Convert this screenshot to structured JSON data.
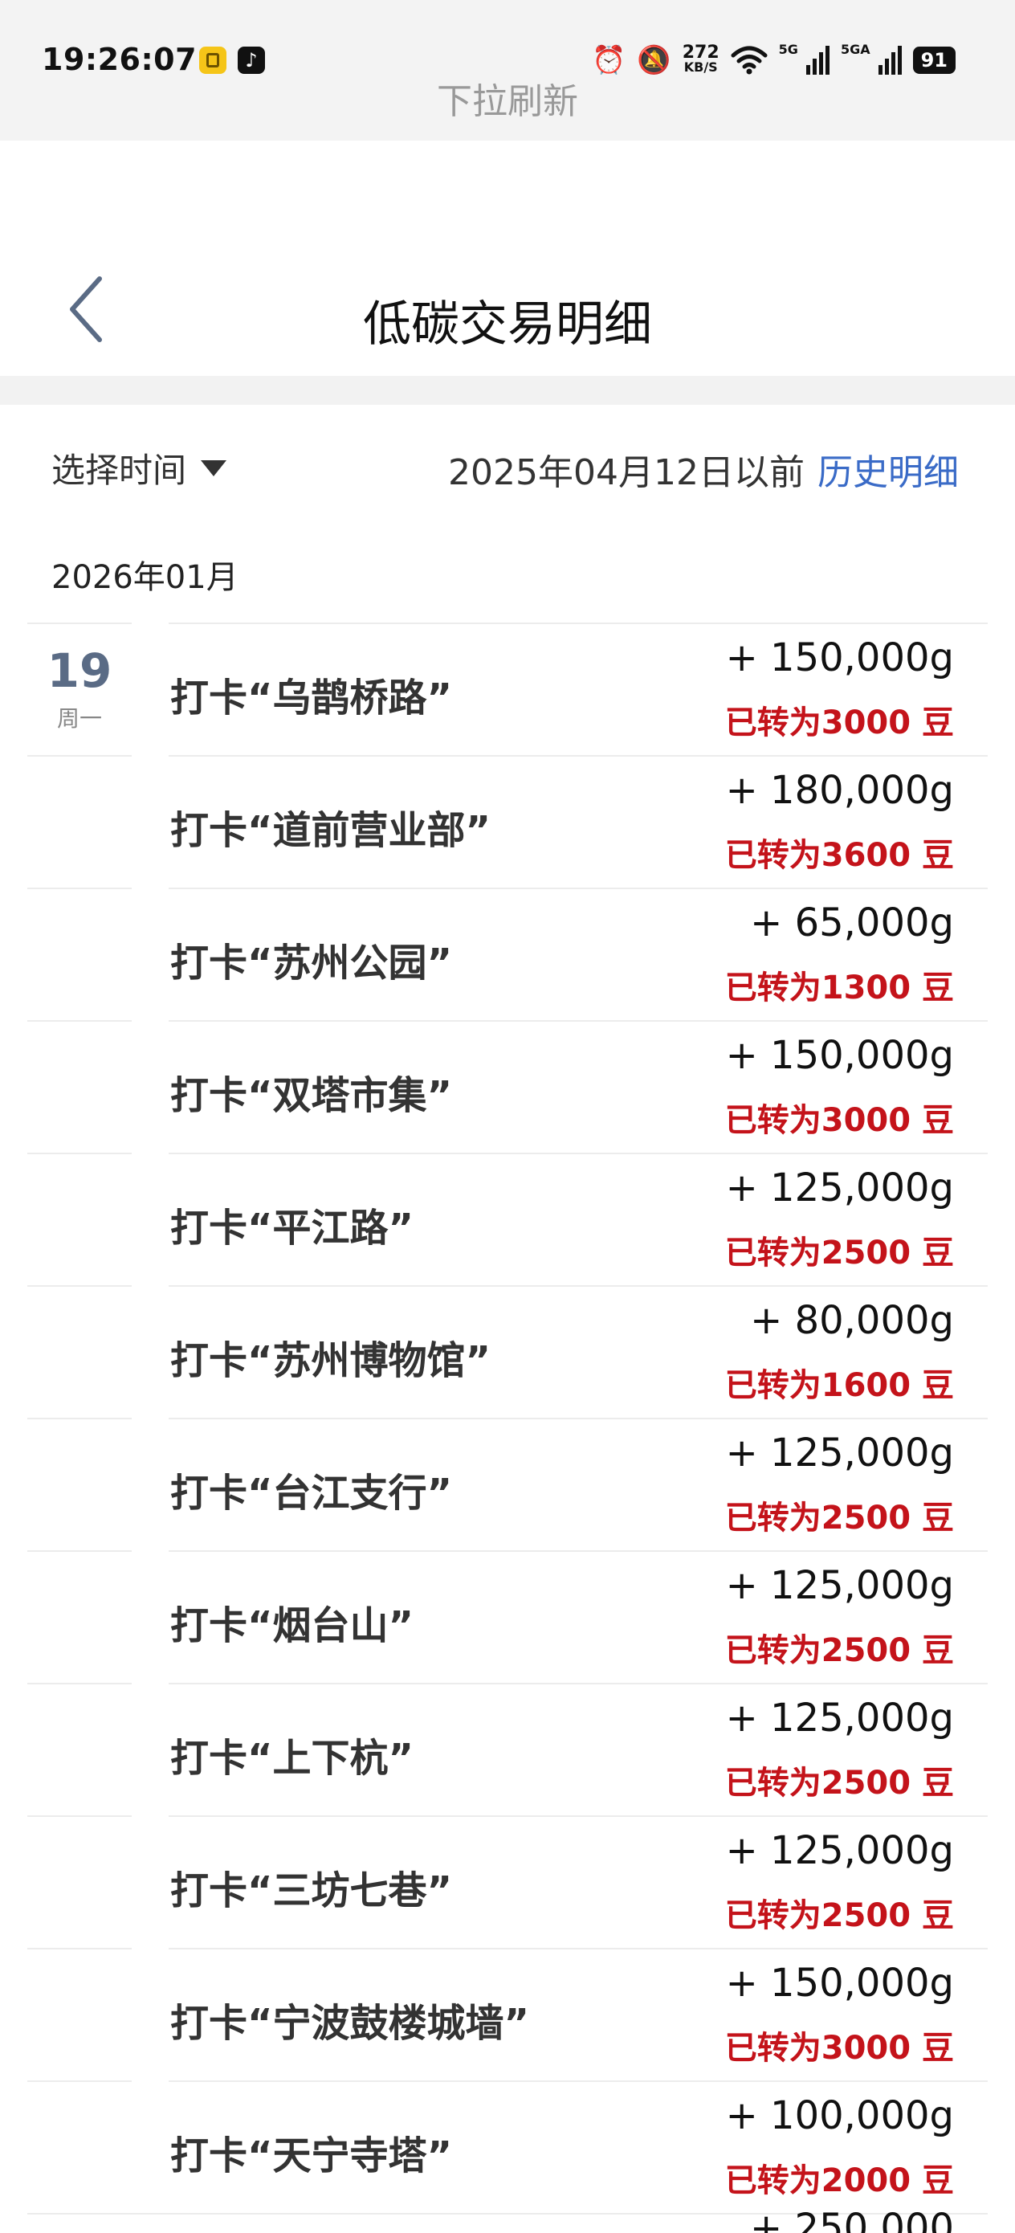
{
  "status_bar": {
    "time": "19:26:07",
    "net_speed_value": "272",
    "net_speed_unit": "KB/S",
    "signal1_label": "5G",
    "signal2_label": "5GA",
    "battery": "91",
    "icons": [
      "alarm-icon",
      "mute-icon",
      "wifi-icon",
      "signal-icon",
      "battery-icon"
    ]
  },
  "pull_refresh_tip": "下拉刷新",
  "header": {
    "title": "低碳交易明细",
    "back_icon": "chevron-left-icon"
  },
  "filter": {
    "time_picker_label": "选择时间",
    "date_note": "2025年04月12日以前",
    "history_link": "历史明细"
  },
  "month": "2026年01月",
  "day": {
    "number": "19",
    "weekday": "周一"
  },
  "items": [
    {
      "title": "打卡“乌鹊桥路”",
      "amount": "+ 150,000g",
      "beans": "已转为3000 豆"
    },
    {
      "title": "打卡“道前营业部”",
      "amount": "+ 180,000g",
      "beans": "已转为3600 豆"
    },
    {
      "title": "打卡“苏州公园”",
      "amount": "+ 65,000g",
      "beans": "已转为1300 豆"
    },
    {
      "title": "打卡“双塔市集”",
      "amount": "+ 150,000g",
      "beans": "已转为3000 豆"
    },
    {
      "title": "打卡“平江路”",
      "amount": "+ 125,000g",
      "beans": "已转为2500 豆"
    },
    {
      "title": "打卡“苏州博物馆”",
      "amount": "+ 80,000g",
      "beans": "已转为1600 豆"
    },
    {
      "title": "打卡“台江支行”",
      "amount": "+ 125,000g",
      "beans": "已转为2500 豆"
    },
    {
      "title": "打卡“烟台山”",
      "amount": "+ 125,000g",
      "beans": "已转为2500 豆"
    },
    {
      "title": "打卡“上下杭”",
      "amount": "+ 125,000g",
      "beans": "已转为2500 豆"
    },
    {
      "title": "打卡“三坊七巷”",
      "amount": "+ 125,000g",
      "beans": "已转为2500 豆"
    },
    {
      "title": "打卡“宁波鼓楼城墙”",
      "amount": "+ 150,000g",
      "beans": "已转为3000 豆"
    },
    {
      "title": "打卡“天宁寺塔”",
      "amount": "+ 100,000g",
      "beans": "已转为2000 豆"
    }
  ],
  "partial_next_amount": "+ 250,000",
  "colors": {
    "accent_link": "#3a6bc7",
    "beans_red": "#c4131a",
    "day_number": "#5a6b85"
  }
}
